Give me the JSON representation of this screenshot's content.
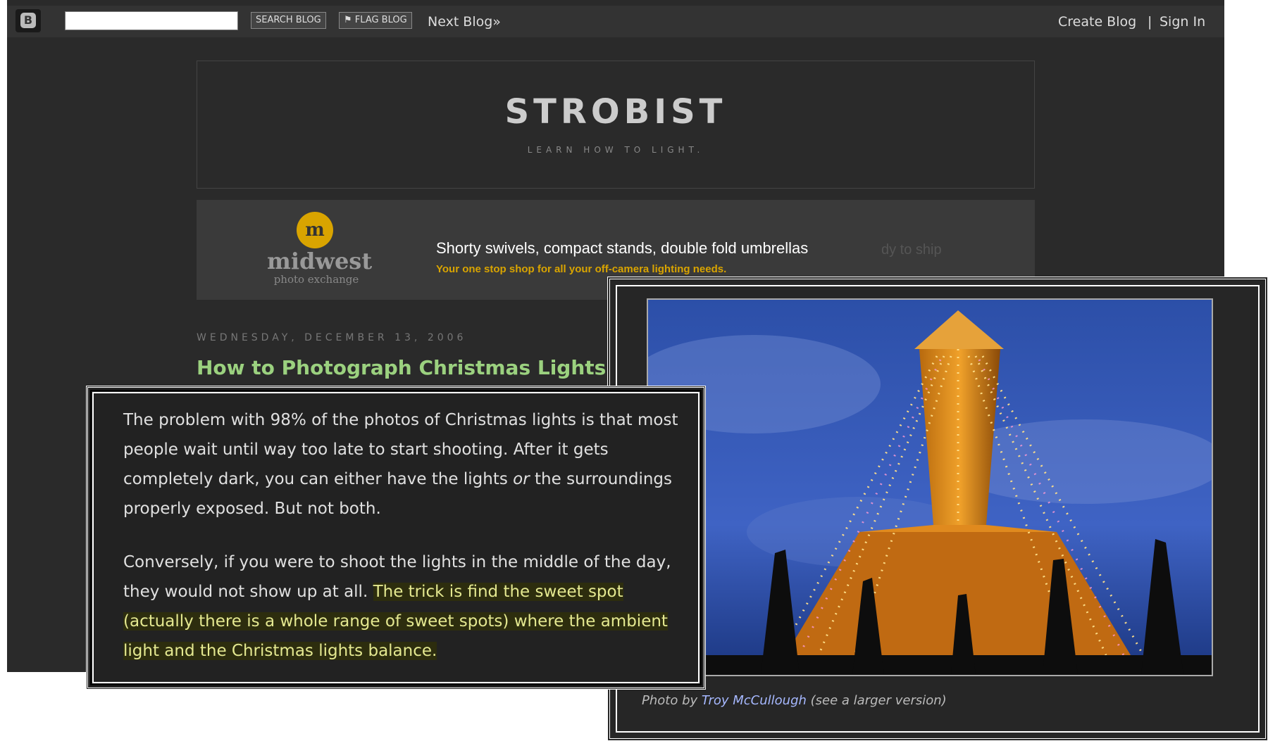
{
  "navbar": {
    "logo_letter": "B",
    "search_placeholder": "",
    "search_button": "SEARCH BLOG",
    "flag_button": "FLAG BLOG",
    "next_blog": "Next Blog»",
    "create_blog": "Create Blog",
    "separator": "|",
    "sign_in": "Sign In"
  },
  "header": {
    "title": "STROBIST",
    "description": "LEARN HOW TO LIGHT."
  },
  "ad": {
    "logo_mark": "m",
    "brand": "midwest",
    "brand_sub": "photo exchange",
    "headline": "Shorty swivels, compact stands, double fold umbrellas",
    "headline_ghost": "dy to ship",
    "tagline": "Your one stop shop for all your off-camera lighting needs."
  },
  "post": {
    "date": "WEDNESDAY, DECEMBER 13, 2006",
    "title": "How to Photograph Christmas Lights",
    "para1_a": "The problem with 98% of the photos of Christmas lights is that most people wait until way too late to start shooting. After it gets completely dark, you can either have the lights ",
    "para1_em": "or",
    "para1_b": " the surroundings properly exposed. But not both.",
    "para2_a": "Conversely, if you were to shoot the lights in the middle of the day, they would not show up at all. ",
    "para2_hl": "The trick is find the sweet spot (actually there is a whole range of sweet spots) where the ambient light and the Christmas lights balance."
  },
  "photo": {
    "caption_prefix": "Photo by ",
    "caption_author": "Troy McCullough",
    "caption_suffix": " (see a larger version)"
  },
  "colors": {
    "background": "#2a2a2a",
    "navbar": "#333333",
    "post_title": "#9bd17f",
    "ad_tagline": "#d9a400",
    "highlight_bg": "#2d2d0e",
    "link": "#a6b8ff"
  }
}
